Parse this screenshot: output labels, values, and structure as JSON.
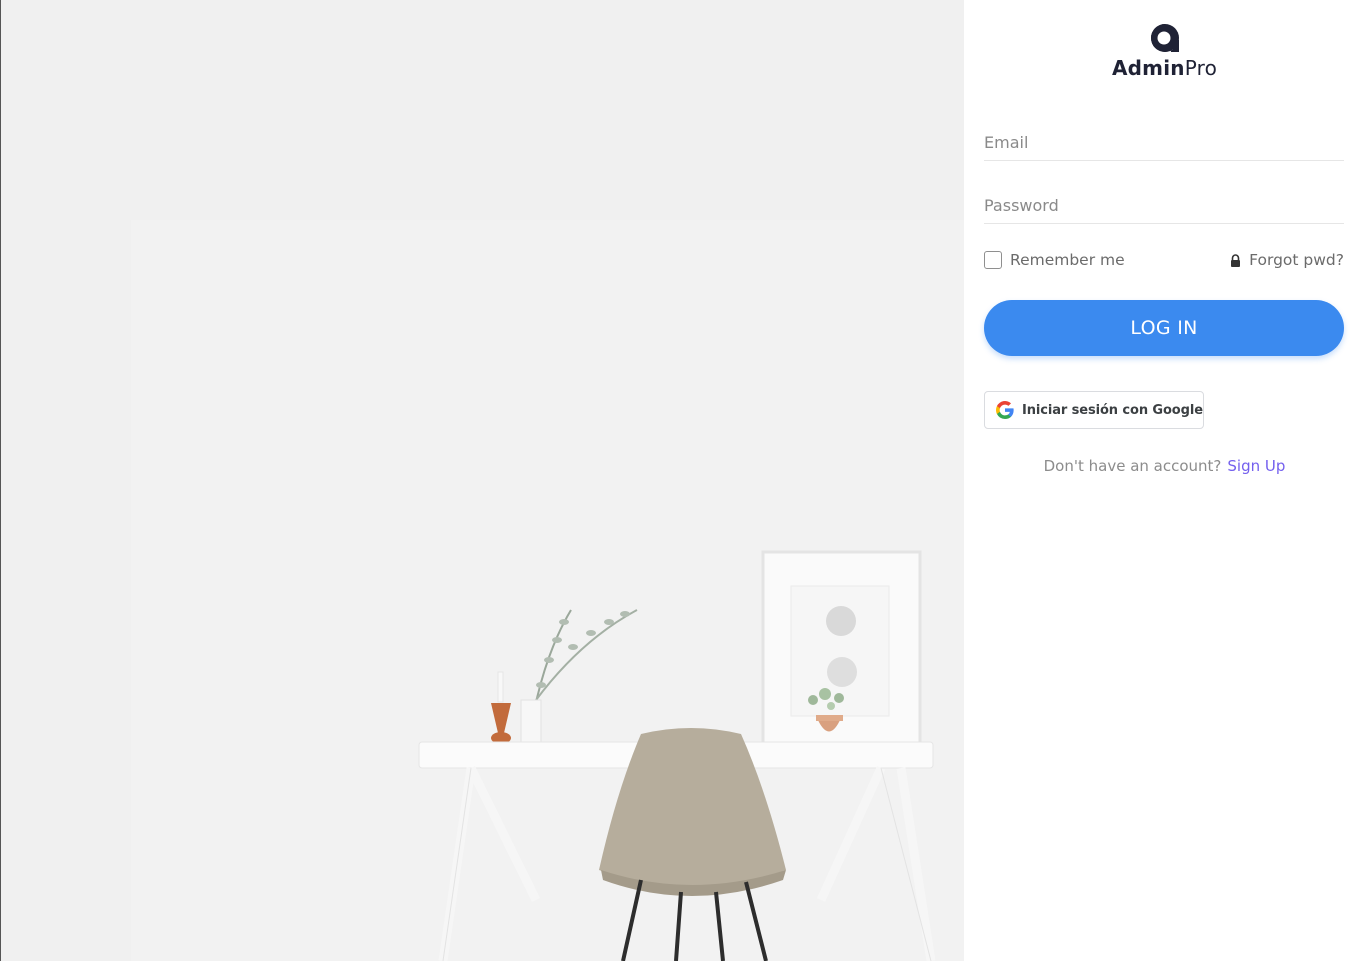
{
  "brand": {
    "name_bold": "Admin",
    "name_light": "Pro"
  },
  "login_form": {
    "email_placeholder": "Email",
    "password_placeholder": "Password",
    "remember_label": "Remember me",
    "remember_checked": false,
    "forgot_label": "Forgot pwd?",
    "login_button": "LOG IN",
    "google_button": "Iniciar sesión con Google",
    "signup_prompt": "Don't have an account?",
    "signup_link": "Sign Up"
  },
  "colors": {
    "primary": "#3b8aef",
    "link": "#7460ee",
    "brand_text": "#1f2235"
  },
  "icons": {
    "logo": "brand-logo-icon",
    "lock": "lock-icon",
    "google": "google-logo-icon"
  }
}
